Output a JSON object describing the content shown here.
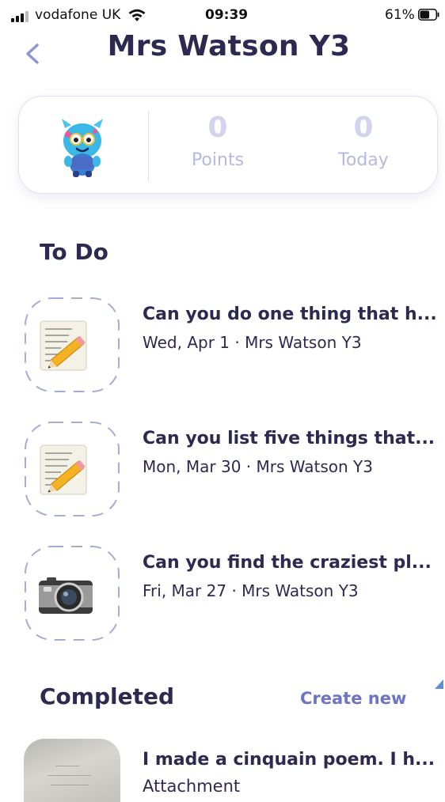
{
  "status_bar": {
    "carrier": "vodafone UK",
    "time": "09:39",
    "battery": "61%",
    "battery_level": 0.61
  },
  "header": {
    "title": "Mrs Watson Y3",
    "back_icon": "chevron-left-icon"
  },
  "stats": {
    "points_value": "0",
    "points_label": "Points",
    "today_value": "0",
    "today_label": "Today"
  },
  "todo": {
    "heading": "To Do",
    "items": [
      {
        "title": "Can you do one thing that h...",
        "subtitle": "Wed, Apr 1 · Mrs Watson Y3",
        "icon": "memo-pencil-icon"
      },
      {
        "title": "Can you list five things that...",
        "subtitle": "Mon, Mar 30 · Mrs Watson Y3",
        "icon": "memo-pencil-icon"
      },
      {
        "title": "Can you find the craziest pl...",
        "subtitle": "Fri, Mar 27 · Mrs Watson Y3",
        "icon": "camera-icon"
      }
    ]
  },
  "completed": {
    "heading": "Completed",
    "create_new": "Create new",
    "items": [
      {
        "title": "I made a cinquain poem. I h...",
        "subtitle": "Attachment"
      }
    ]
  },
  "colors": {
    "text_dark": "#2c2a50",
    "accent": "#6d74c3",
    "stat_muted": "#b6b9df",
    "dash_border": "#a7abd8"
  }
}
